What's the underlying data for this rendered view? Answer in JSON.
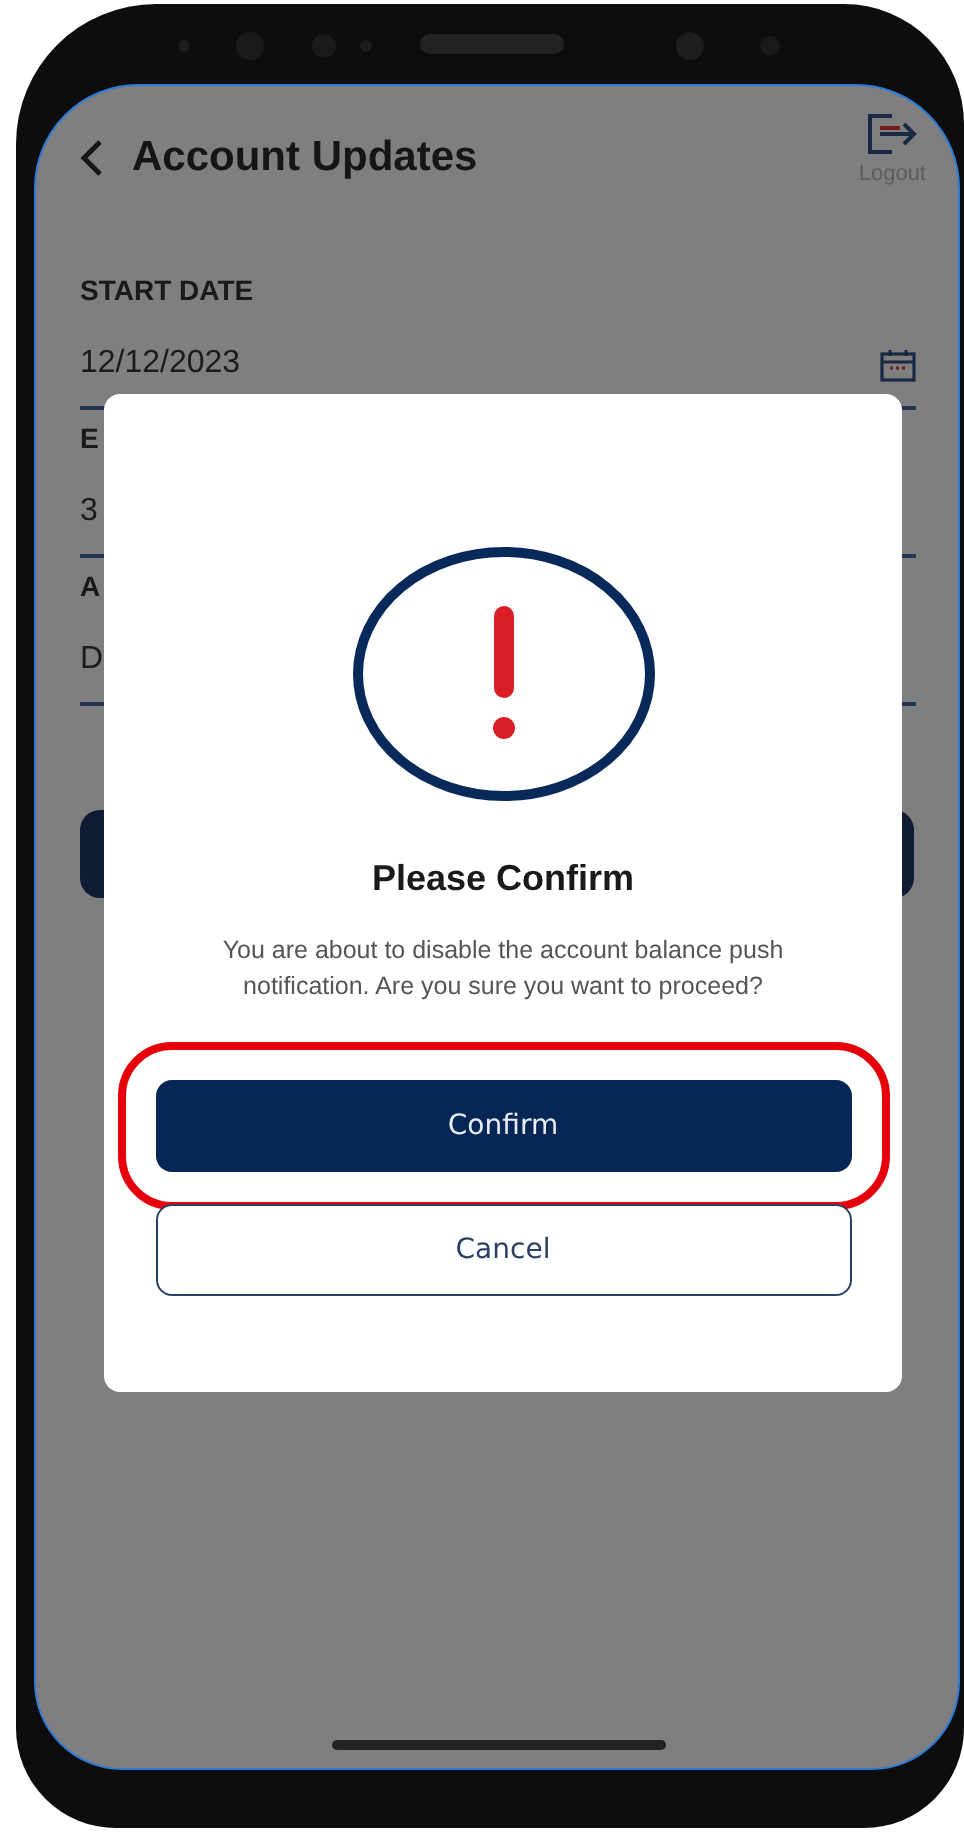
{
  "app": {
    "title": "Account Updates",
    "logout_label": "Logout"
  },
  "form": {
    "fields": [
      {
        "label": "START DATE",
        "value": "12/12/2023",
        "kind": "date"
      },
      {
        "label": "E",
        "value": "3",
        "kind": "text"
      },
      {
        "label": "A",
        "value": "D",
        "kind": "text"
      }
    ]
  },
  "dialog": {
    "title": "Please Confirm",
    "message": "You are about to disable the account balance push notification. Are you sure you want to proceed?",
    "buttons": [
      {
        "label": "Confirm",
        "kind": "primary",
        "highlighted": true
      },
      {
        "label": "Cancel",
        "kind": "secondary",
        "highlighted": false
      }
    ]
  }
}
